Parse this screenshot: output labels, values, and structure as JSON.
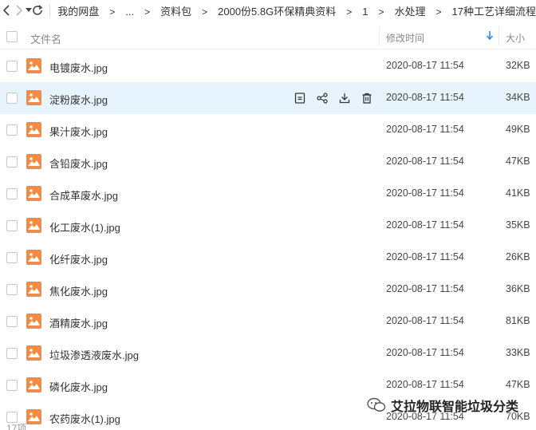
{
  "breadcrumbs": [
    "我的网盘",
    "...",
    "资料包",
    "2000份5.8G环保精典资料",
    "1",
    "水处理",
    "17种工艺详细流程"
  ],
  "header": {
    "name_label": "文件名",
    "time_label": "修改时间",
    "sort_icon": "arrow-down-icon",
    "size_label": "大小"
  },
  "accent_color": "#2d8cf0",
  "file_icon_color": "#f08c48",
  "hover_row_color": "#e8f4fd",
  "files": [
    {
      "name": "电镀废水.jpg",
      "time": "2020-08-17 11:54",
      "size": "32KB"
    },
    {
      "name": "淀粉废水.jpg",
      "time": "2020-08-17 11:54",
      "size": "34KB"
    },
    {
      "name": "果汁废水.jpg",
      "time": "2020-08-17 11:54",
      "size": "49KB"
    },
    {
      "name": "含铅废水.jpg",
      "time": "2020-08-17 11:54",
      "size": "47KB"
    },
    {
      "name": "合成革废水.jpg",
      "time": "2020-08-17 11:54",
      "size": "41KB"
    },
    {
      "name": "化工废水(1).jpg",
      "time": "2020-08-17 11:54",
      "size": "35KB"
    },
    {
      "name": "化纤废水.jpg",
      "time": "2020-08-17 11:54",
      "size": "26KB"
    },
    {
      "name": "焦化废水.jpg",
      "time": "2020-08-17 11:54",
      "size": "36KB"
    },
    {
      "name": "酒精废水.jpg",
      "time": "2020-08-17 11:54",
      "size": "81KB"
    },
    {
      "name": "垃圾渗透液废水.jpg",
      "time": "2020-08-17 11:54",
      "size": "33KB"
    },
    {
      "name": "磷化废水.jpg",
      "time": "2020-08-17 11:54",
      "size": "47KB"
    },
    {
      "name": "农药废水(1).jpg",
      "time": "2020-08-17 11:54",
      "size": "70KB"
    }
  ],
  "row_actions": [
    "preview-icon",
    "share-icon",
    "download-icon",
    "delete-icon"
  ],
  "footer_text": "17项",
  "watermark_text": "艾拉物联智能垃圾分类"
}
